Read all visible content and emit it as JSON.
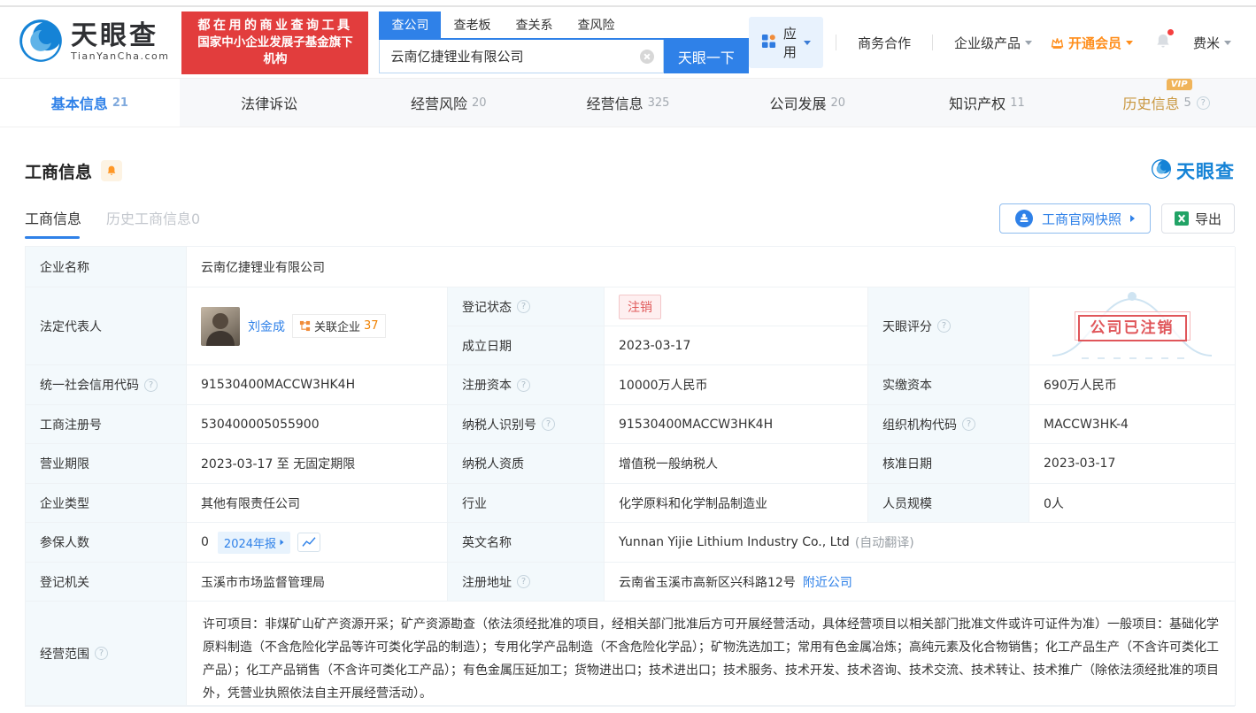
{
  "glyphs": {
    "help": "?"
  },
  "colors": {
    "brand_blue": "#2f81e8",
    "promo_red": "#e23d3d",
    "vip_orange": "#ff8d1a",
    "gold": "#c9973f",
    "status_red": "#e05b5b",
    "label_bg": "#f3f9fc",
    "excel_green": "#21a366"
  },
  "header": {
    "logo": {
      "name": "天眼查",
      "domain": "TianYanCha.com"
    },
    "promo": {
      "line1": "都在用的商业查询工具",
      "line2": "国家中小企业发展子基金旗下机构"
    },
    "search": {
      "tabs": [
        {
          "label": "查公司"
        },
        {
          "label": "查老板"
        },
        {
          "label": "查关系"
        },
        {
          "label": "查风险"
        }
      ],
      "value": "云南亿捷锂业有限公司",
      "button": "天眼一下"
    },
    "nav": {
      "apps": "应用",
      "cooperation": "商务合作",
      "enterprise": "企业级产品",
      "vip": "开通会员",
      "username": "费米"
    }
  },
  "tabs": [
    {
      "label": "基本信息",
      "count": "21"
    },
    {
      "label": "法律诉讼",
      "count": ""
    },
    {
      "label": "经营风险",
      "count": "20"
    },
    {
      "label": "经营信息",
      "count": "325"
    },
    {
      "label": "公司发展",
      "count": "20"
    },
    {
      "label": "知识产权",
      "count": "11"
    },
    {
      "label": "历史信息",
      "count": "5",
      "vip_badge": "VIP"
    }
  ],
  "section": {
    "title": "工商信息",
    "subtabs": [
      {
        "label": "工商信息"
      },
      {
        "label": "历史工商信息0"
      }
    ],
    "snapshot_button": "工商官网快照",
    "export_button": "导出",
    "watermark": "天眼查"
  },
  "fields": {
    "company_name": {
      "label": "企业名称",
      "value": "云南亿捷锂业有限公司"
    },
    "legal_rep": {
      "label": "法定代表人",
      "name": "刘金成",
      "related_label": "关联企业",
      "related_count": "37"
    },
    "reg_status": {
      "label": "登记状态",
      "value": "注销"
    },
    "establish_date": {
      "label": "成立日期",
      "value": "2023-03-17"
    },
    "score": {
      "label": "天眼评分",
      "stamp": "公司已注销"
    },
    "credit_code": {
      "label": "统一社会信用代码",
      "value": "91530400MACCW3HK4H"
    },
    "reg_capital": {
      "label": "注册资本",
      "value": "10000万人民币"
    },
    "paid_capital": {
      "label": "实缴资本",
      "value": "690万人民币"
    },
    "reg_number": {
      "label": "工商注册号",
      "value": "530400005055900"
    },
    "taxpayer_id": {
      "label": "纳税人识别号",
      "value": "91530400MACCW3HK4H"
    },
    "org_code": {
      "label": "组织机构代码",
      "value": "MACCW3HK-4"
    },
    "business_term": {
      "label": "营业期限",
      "value": "2023-03-17 至 无固定期限"
    },
    "taxpayer_quality": {
      "label": "纳税人资质",
      "value": "增值税一般纳税人"
    },
    "approval_date": {
      "label": "核准日期",
      "value": "2023-03-17"
    },
    "company_type": {
      "label": "企业类型",
      "value": "其他有限责任公司"
    },
    "industry": {
      "label": "行业",
      "value": "化学原料和化学制品制造业"
    },
    "staff_size": {
      "label": "人员规模",
      "value": "0人"
    },
    "insured": {
      "label": "参保人数",
      "value": "0",
      "report_badge": "2024年报"
    },
    "english_name": {
      "label": "英文名称",
      "value": "Yunnan Yijie Lithium Industry Co., Ltd",
      "note": "(自动翻译)"
    },
    "reg_authority": {
      "label": "登记机关",
      "value": "玉溪市市场监督管理局"
    },
    "reg_address": {
      "label": "注册地址",
      "value": "云南省玉溪市高新区兴科路12号",
      "nearby_link": "附近公司"
    },
    "business_scope": {
      "label": "经营范围",
      "value": "许可项目：非煤矿山矿产资源开采；矿产资源勘查（依法须经批准的项目，经相关部门批准后方可开展经营活动，具体经营项目以相关部门批准文件或许可证件为准）一般项目：基础化学原料制造（不含危险化学品等许可类化学品的制造）；专用化学产品制造（不含危险化学品）；矿物洗选加工；常用有色金属冶炼；高纯元素及化合物销售；化工产品生产（不含许可类化工产品）；化工产品销售（不含许可类化工产品）；有色金属压延加工；货物进出口；技术进出口；技术服务、技术开发、技术咨询、技术交流、技术转让、技术推广（除依法须经批准的项目外，凭营业执照依法自主开展经营活动）。"
    }
  }
}
